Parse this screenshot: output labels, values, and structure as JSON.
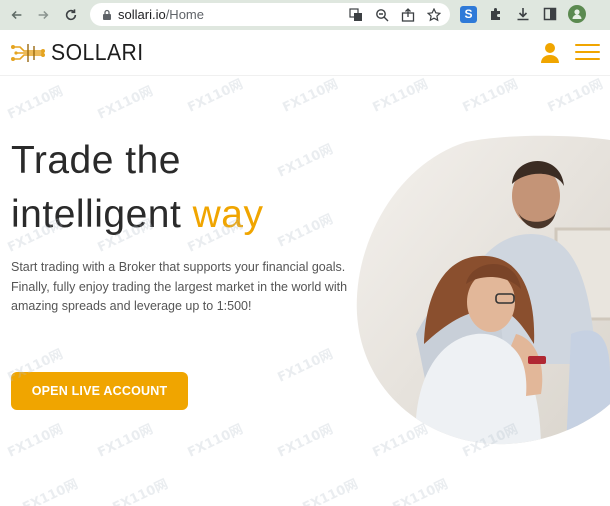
{
  "browser": {
    "url_host": "sollari.io",
    "url_path": "/Home"
  },
  "site": {
    "brand": "SOLLARI",
    "accent_color": "#f0a500"
  },
  "hero": {
    "title_line1": "Trade the",
    "title_line2_prefix": "intelligent",
    "title_line2_accent": "way",
    "paragraph1": "Start trading with a Broker that supports your financial goals.",
    "paragraph2": "Finally, fully enjoy trading the largest market in the world with amazing spreads and leverage up to 1:500!",
    "cta_label": "OPEN LIVE ACCOUNT"
  },
  "watermark": "FX110网"
}
